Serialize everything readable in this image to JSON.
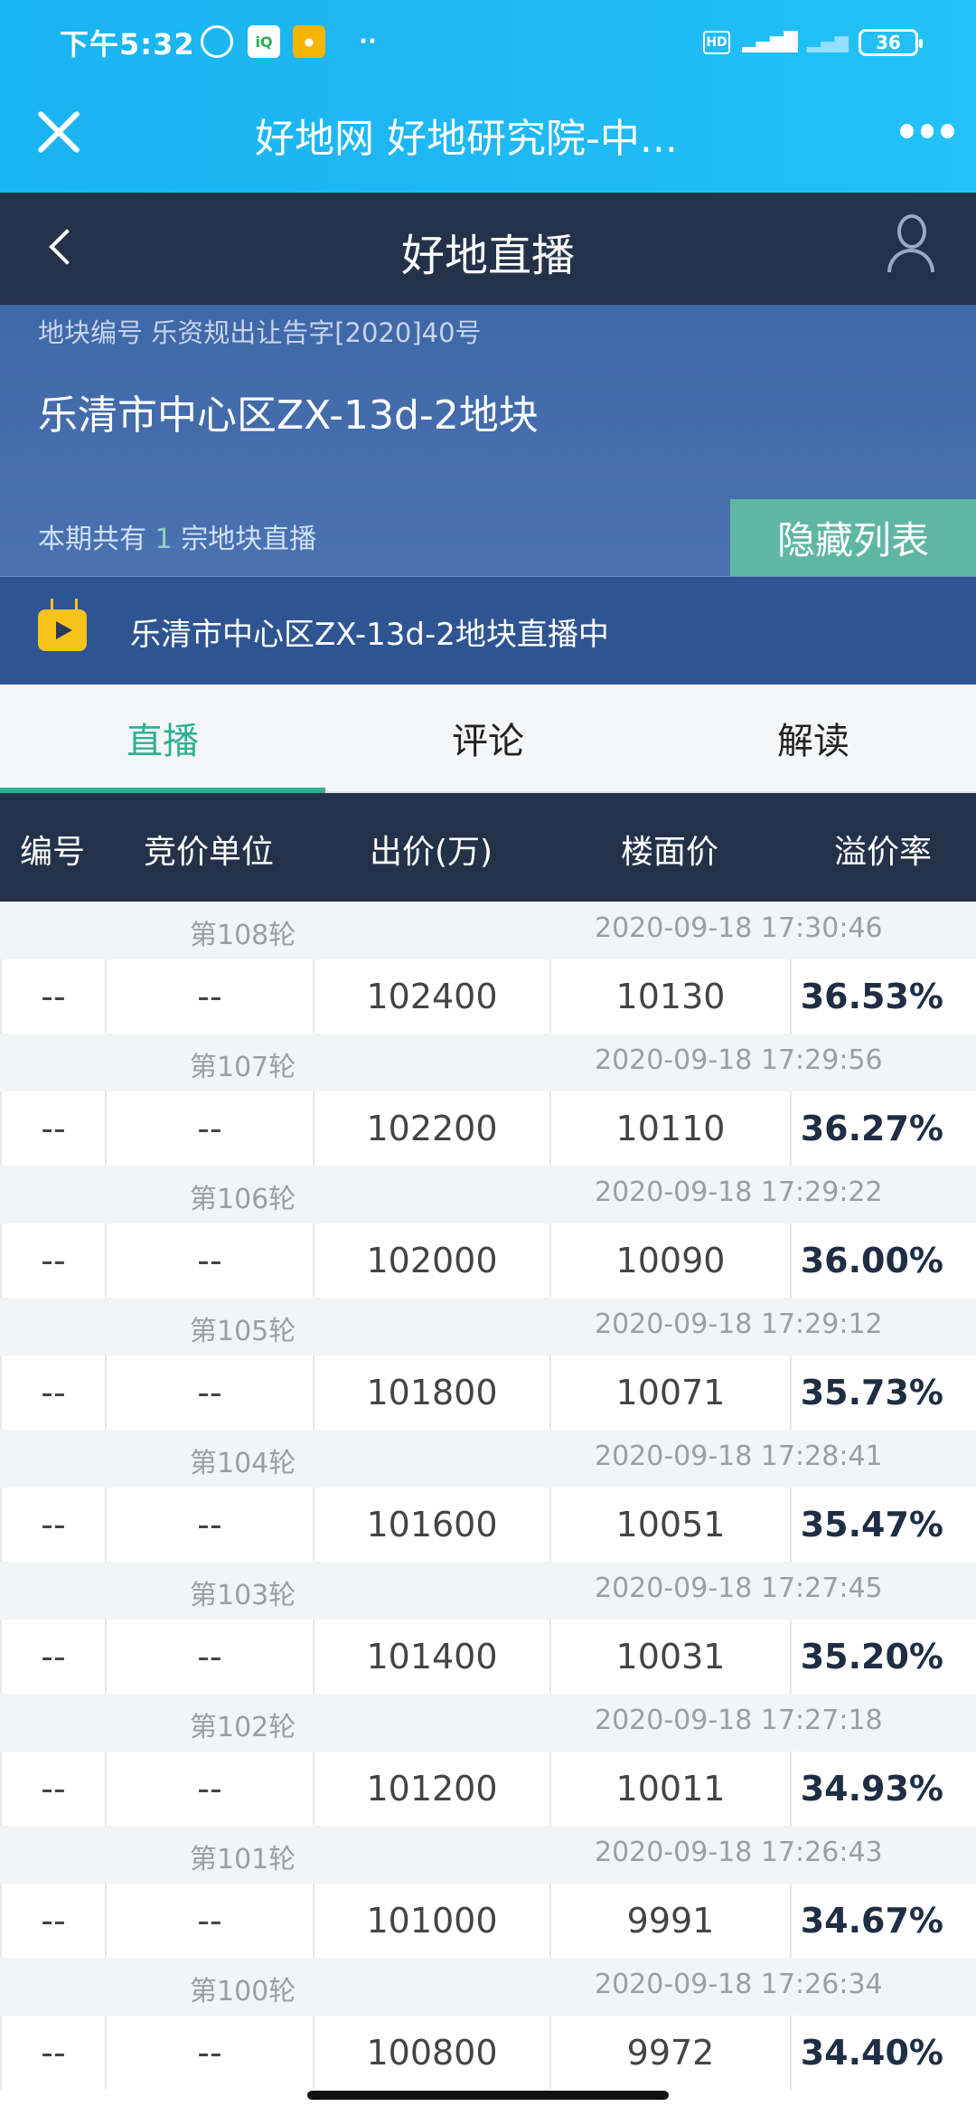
{
  "status_bar": {
    "time": "下午5:32",
    "icons": [
      "alarm-icon",
      "iqiyi-icon",
      "app-icon",
      "more-dots-icon",
      "hd-icon",
      "signal-4g-icon",
      "signal-icon"
    ],
    "battery": "36"
  },
  "wechat_header": {
    "title": "好地网 好地研究院-中..."
  },
  "app_nav": {
    "title": "好地直播"
  },
  "plot": {
    "code_label": "地块编号 乐资规出让告字[2020]40号",
    "name": "乐清市中心区ZX-13d-2地块",
    "count_prefix": "本期共有",
    "count_num": "1",
    "count_suffix": "宗地块直播",
    "hide_button": "隐藏列表"
  },
  "live_bar": {
    "text": "乐清市中心区ZX-13d-2地块直播中"
  },
  "tabs": [
    {
      "label": "直播"
    },
    {
      "label": "评论"
    },
    {
      "label": "解读"
    }
  ],
  "table": {
    "headers": [
      "编号",
      "竞价单位",
      "出价(万)",
      "楼面价",
      "溢价率"
    ],
    "rounds": [
      {
        "round": "第108轮",
        "time": "2020-09-18 17:30:46",
        "id": "--",
        "bidder": "--",
        "bid": "102400",
        "floor_price": "10130",
        "premium": "36.53%"
      },
      {
        "round": "第107轮",
        "time": "2020-09-18 17:29:56",
        "id": "--",
        "bidder": "--",
        "bid": "102200",
        "floor_price": "10110",
        "premium": "36.27%"
      },
      {
        "round": "第106轮",
        "time": "2020-09-18 17:29:22",
        "id": "--",
        "bidder": "--",
        "bid": "102000",
        "floor_price": "10090",
        "premium": "36.00%"
      },
      {
        "round": "第105轮",
        "time": "2020-09-18 17:29:12",
        "id": "--",
        "bidder": "--",
        "bid": "101800",
        "floor_price": "10071",
        "premium": "35.73%"
      },
      {
        "round": "第104轮",
        "time": "2020-09-18 17:28:41",
        "id": "--",
        "bidder": "--",
        "bid": "101600",
        "floor_price": "10051",
        "premium": "35.47%"
      },
      {
        "round": "第103轮",
        "time": "2020-09-18 17:27:45",
        "id": "--",
        "bidder": "--",
        "bid": "101400",
        "floor_price": "10031",
        "premium": "35.20%"
      },
      {
        "round": "第102轮",
        "time": "2020-09-18 17:27:18",
        "id": "--",
        "bidder": "--",
        "bid": "101200",
        "floor_price": "10011",
        "premium": "34.93%"
      },
      {
        "round": "第101轮",
        "time": "2020-09-18 17:26:43",
        "id": "--",
        "bidder": "--",
        "bid": "101000",
        "floor_price": "9991",
        "premium": "34.67%"
      },
      {
        "round": "第100轮",
        "time": "2020-09-18 17:26:34",
        "id": "--",
        "bidder": "--",
        "bid": "100800",
        "floor_price": "9972",
        "premium": "34.40%"
      }
    ]
  },
  "colors": {
    "accent": "#2fb093",
    "nav_bg": "#243249",
    "plot_bg": "#4a72b0",
    "wechat_bg": "#1fb8f4"
  }
}
